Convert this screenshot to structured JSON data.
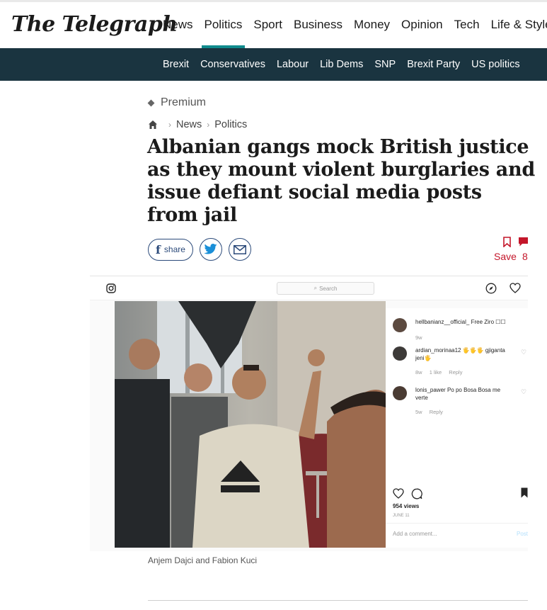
{
  "header": {
    "logo": "The Telegraph",
    "nav": [
      "News",
      "Politics",
      "Sport",
      "Business",
      "Money",
      "Opinion",
      "Tech",
      "Life & Style"
    ],
    "active_nav": "Politics",
    "accent_color": "#0f8b8d"
  },
  "subnav": {
    "items": [
      "Brexit",
      "Conservatives",
      "Labour",
      "Lib Dems",
      "SNP",
      "Brexit Party",
      "US politics"
    ],
    "background": "#1a3440"
  },
  "article": {
    "premium_label": "Premium",
    "breadcrumb": [
      "News",
      "Politics"
    ],
    "headline": "Albanian gangs mock British justice as they mount violent burglaries and issue defiant social media posts from jail",
    "share_label": "share",
    "save_label": "Save",
    "comment_count": "8",
    "caption": "Anjem Dajci and Fabion Kuci"
  },
  "instagram": {
    "search_placeholder": "Search",
    "comments": [
      {
        "user": "hellbanianz__official_",
        "text": "Free Ziro ☐☐",
        "time": "9w",
        "likes": "",
        "reply": ""
      },
      {
        "user": "ardian_morinaa12",
        "text": "🖐🖐🖐 gjiganta jeni🖐",
        "time": "8w",
        "likes": "1 like",
        "reply": "Reply"
      },
      {
        "user": "lonis_pawer",
        "text": "Po po Bosa Bosa me verte",
        "time": "5w",
        "likes": "",
        "reply": "Reply"
      }
    ],
    "views": "954 views",
    "date": "JUNE 11",
    "add_comment_placeholder": "Add a comment...",
    "post_label": "Post"
  }
}
